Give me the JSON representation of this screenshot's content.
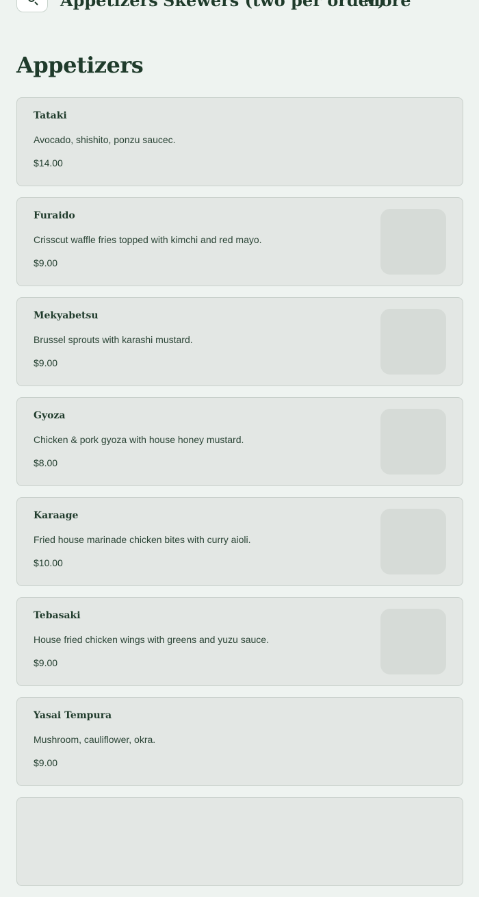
{
  "nav": {
    "tabs": [
      {
        "label": "Appetizers"
      },
      {
        "label": "Skewers (two per order)"
      },
      {
        "label": "More"
      }
    ],
    "search_icon": "search-icon"
  },
  "section": {
    "title": "Appetizers"
  },
  "items": [
    {
      "name": "Tataki",
      "description": "Avocado, shishito, ponzu saucec.",
      "price": "$14.00",
      "has_image": false
    },
    {
      "name": "Furaido",
      "description": "Crisscut waffle fries topped with kimchi and red mayo.",
      "price": "$9.00",
      "has_image": true
    },
    {
      "name": "Mekyabetsu",
      "description": "Brussel sprouts with karashi mustard.",
      "price": "$9.00",
      "has_image": true
    },
    {
      "name": "Gyoza",
      "description": "Chicken & pork gyoza with house honey mustard.",
      "price": "$8.00",
      "has_image": true
    },
    {
      "name": "Karaage",
      "description": "Fried house marinade chicken bites with curry aioli.",
      "price": "$10.00",
      "has_image": true
    },
    {
      "name": "Tebasaki",
      "description": "House fried chicken wings with greens and yuzu sauce.",
      "price": "$9.00",
      "has_image": true
    },
    {
      "name": "Yasai Tempura",
      "description": "Mushroom, cauliflower, okra.",
      "price": "$9.00",
      "has_image": false
    }
  ],
  "colors": {
    "background": "#eef3f0",
    "card": "#e3e7e4",
    "text": "#1f3b2b",
    "thumbnail_placeholder": "#d6dbd7"
  }
}
